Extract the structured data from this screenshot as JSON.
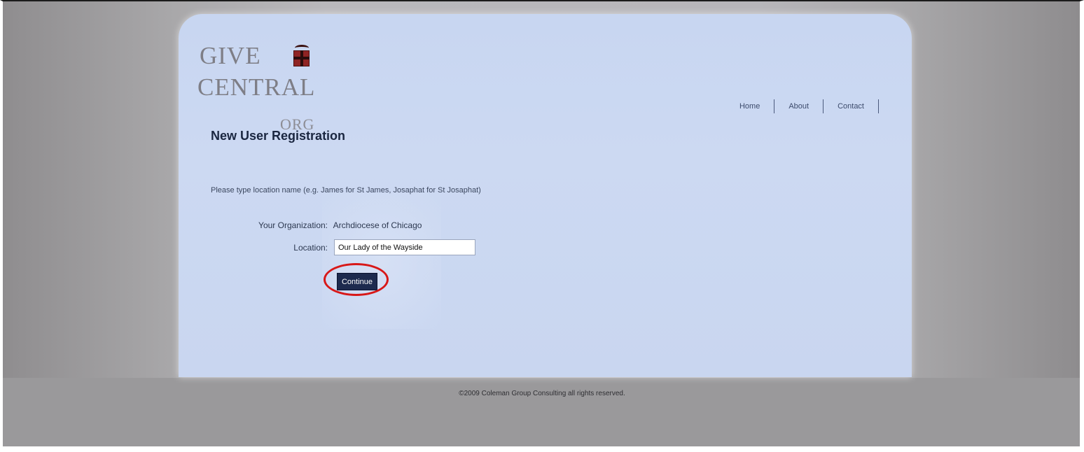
{
  "brand": {
    "logo_line1": "GIVE",
    "logo_line2": "CENTRAL",
    "logo_line3": "ORG"
  },
  "nav": {
    "items": [
      {
        "label": "Home"
      },
      {
        "label": "About"
      },
      {
        "label": "Contact"
      }
    ]
  },
  "page": {
    "title": "New User Registration",
    "hint": "Please type location name (e.g. James for St James, Josaphat for St Josaphat)"
  },
  "form": {
    "organization_label": "Your Organization:",
    "organization_value": "Archdiocese of Chicago",
    "location_label": "Location:",
    "location_value": "Our Lady of the Wayside",
    "continue_label": "Continue"
  },
  "footer": {
    "text": "©2009 Coleman Group Consulting all rights reserved."
  },
  "colors": {
    "card_background": "#c8d6f1",
    "button": "#1d2a4e",
    "highlight_ring": "#d81818",
    "logo_gift": "#8f2424"
  }
}
